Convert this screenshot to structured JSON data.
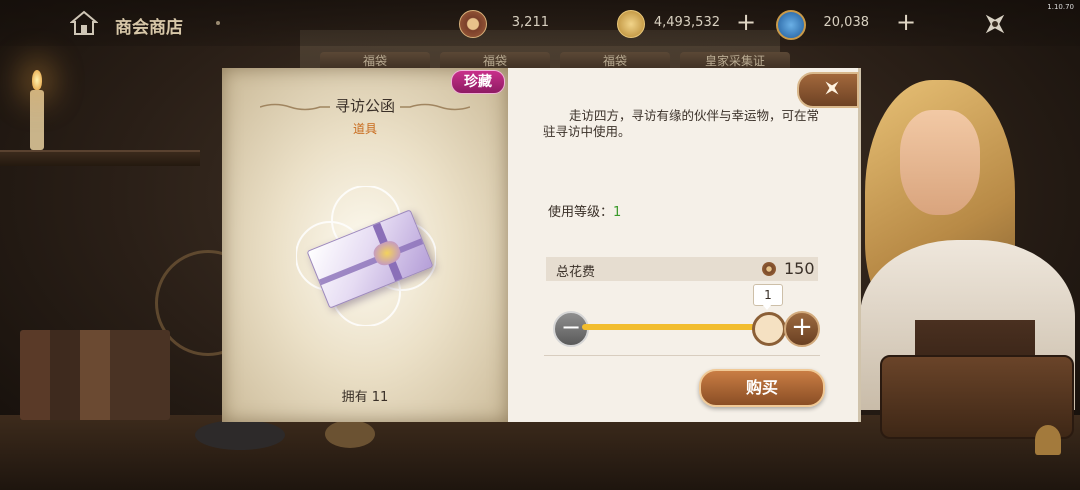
{
  "app": {
    "version": "1.10.70"
  },
  "header": {
    "title": "商会商店",
    "currencies": [
      {
        "icon": "guild-coin-icon",
        "value": "3,211",
        "has_plus": false
      },
      {
        "icon": "gold-coin-icon",
        "value": "4,493,532",
        "has_plus": true
      },
      {
        "icon": "gem-globe-icon",
        "value": "20,038",
        "has_plus": true
      }
    ]
  },
  "tabs": [
    "福袋",
    "福袋",
    "福袋",
    "皇家采集证"
  ],
  "item": {
    "rarity": "珍藏",
    "name": "寻访公函",
    "type": "道具",
    "owned": "拥有 11",
    "description": "走访四方，寻访有缘的伙伴与幸运物，可在常驻寻访中使用。",
    "level_label": "使用等级：",
    "level_value": "1"
  },
  "purchase": {
    "cost_label": "总花费",
    "cost_value": "150",
    "quantity": "1",
    "slider_fraction": 1.0,
    "buy_label": "购买"
  },
  "colors": {
    "rarity_bg": "#b0247a",
    "type_text": "#c86a1c",
    "level_value": "#3a9a2a",
    "slider_fill": "#f2bd2e",
    "buy_button": "#a8633a"
  }
}
